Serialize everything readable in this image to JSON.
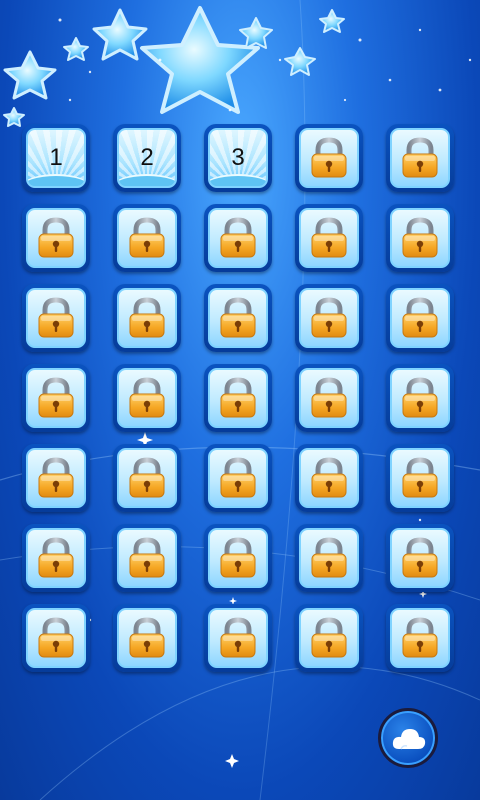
{
  "game": {
    "screen": "level-select",
    "levels": [
      {
        "label": "1",
        "locked": false
      },
      {
        "label": "2",
        "locked": false
      },
      {
        "label": "3",
        "locked": false
      },
      {
        "label": "",
        "locked": true
      },
      {
        "label": "",
        "locked": true
      },
      {
        "label": "",
        "locked": true
      },
      {
        "label": "",
        "locked": true
      },
      {
        "label": "",
        "locked": true
      },
      {
        "label": "",
        "locked": true
      },
      {
        "label": "",
        "locked": true
      },
      {
        "label": "",
        "locked": true
      },
      {
        "label": "",
        "locked": true
      },
      {
        "label": "",
        "locked": true
      },
      {
        "label": "",
        "locked": true
      },
      {
        "label": "",
        "locked": true
      },
      {
        "label": "",
        "locked": true
      },
      {
        "label": "",
        "locked": true
      },
      {
        "label": "",
        "locked": true
      },
      {
        "label": "",
        "locked": true
      },
      {
        "label": "",
        "locked": true
      },
      {
        "label": "",
        "locked": true
      },
      {
        "label": "",
        "locked": true
      },
      {
        "label": "",
        "locked": true
      },
      {
        "label": "",
        "locked": true
      },
      {
        "label": "",
        "locked": true
      },
      {
        "label": "",
        "locked": true
      },
      {
        "label": "",
        "locked": true
      },
      {
        "label": "",
        "locked": true
      },
      {
        "label": "",
        "locked": true
      },
      {
        "label": "",
        "locked": true
      },
      {
        "label": "",
        "locked": true
      },
      {
        "label": "",
        "locked": true
      },
      {
        "label": "",
        "locked": true
      },
      {
        "label": "",
        "locked": true
      },
      {
        "label": "",
        "locked": true
      }
    ],
    "back_button_icon": "cloud-icon",
    "lock_icon": "padlock-icon"
  },
  "colors": {
    "background_top": "#4aa8ff",
    "background_bottom": "#083a9c",
    "tile_frame": "#0a53c0",
    "tile_face": "#bfeaff",
    "lock_body": "#f5a623",
    "lock_shackle": "#9aa3ad"
  }
}
